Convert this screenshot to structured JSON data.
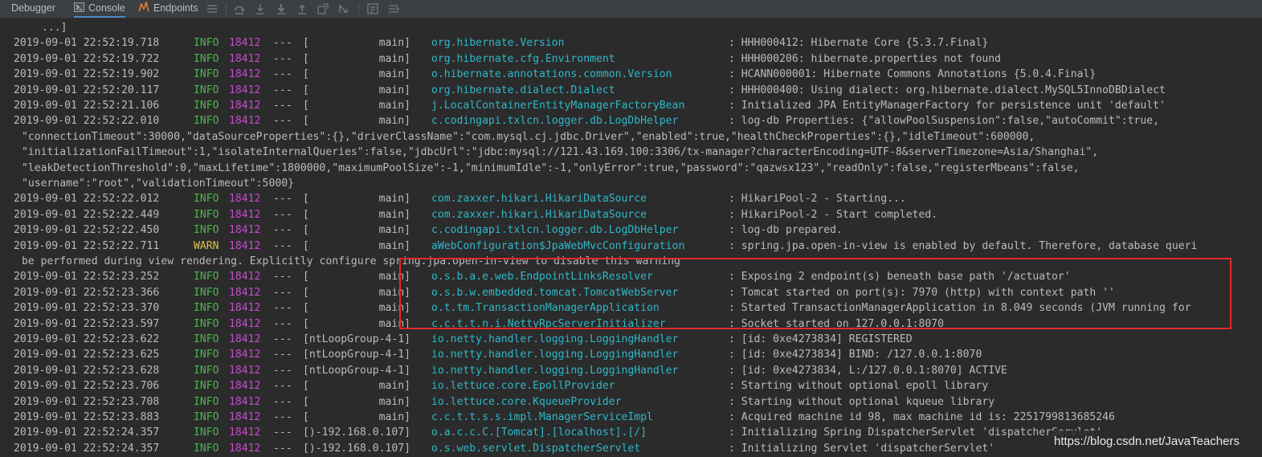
{
  "toolbar": {
    "tabs": [
      {
        "label": "Debugger",
        "active": false
      },
      {
        "label": "Console",
        "active": true
      },
      {
        "label": "Endpoints",
        "active": false
      }
    ]
  },
  "console": {
    "continuation_top": "...]",
    "rows": [
      {
        "time": "2019-09-01 22:52:19.718",
        "level": "INFO",
        "pid": "18412",
        "sep": "---",
        "thread": "[           main]",
        "logger": "org.hibernate.Version",
        "message": ": HHH000412: Hibernate Core {5.3.7.Final}"
      },
      {
        "time": "2019-09-01 22:52:19.722",
        "level": "INFO",
        "pid": "18412",
        "sep": "---",
        "thread": "[           main]",
        "logger": "org.hibernate.cfg.Environment",
        "message": ": HHH000206: hibernate.properties not found"
      },
      {
        "time": "2019-09-01 22:52:19.902",
        "level": "INFO",
        "pid": "18412",
        "sep": "---",
        "thread": "[           main]",
        "logger": "o.hibernate.annotations.common.Version",
        "message": ": HCANN000001: Hibernate Commons Annotations {5.0.4.Final}"
      },
      {
        "time": "2019-09-01 22:52:20.117",
        "level": "INFO",
        "pid": "18412",
        "sep": "---",
        "thread": "[           main]",
        "logger": "org.hibernate.dialect.Dialect",
        "message": ": HHH000400: Using dialect: org.hibernate.dialect.MySQL5InnoDBDialect"
      },
      {
        "time": "2019-09-01 22:52:21.106",
        "level": "INFO",
        "pid": "18412",
        "sep": "---",
        "thread": "[           main]",
        "logger": "j.LocalContainerEntityManagerFactoryBean",
        "message": ": Initialized JPA EntityManagerFactory for persistence unit 'default'"
      },
      {
        "time": "2019-09-01 22:52:22.010",
        "level": "INFO",
        "pid": "18412",
        "sep": "---",
        "thread": "[           main]",
        "logger": "c.codingapi.txlcn.logger.db.LogDbHelper",
        "message": ": log-db Properties: {\"allowPoolSuspension\":false,\"autoCommit\":true,"
      },
      {
        "continuation": "\"connectionTimeout\":30000,\"dataSourceProperties\":{},\"driverClassName\":\"com.mysql.cj.jdbc.Driver\",\"enabled\":true,\"healthCheckProperties\":{},\"idleTimeout\":600000,"
      },
      {
        "continuation": "\"initializationFailTimeout\":1,\"isolateInternalQueries\":false,\"jdbcUrl\":\"jdbc:mysql://121.43.169.100:3306/tx-manager?characterEncoding=UTF-8&serverTimezone=Asia/Shanghai\","
      },
      {
        "continuation": "\"leakDetectionThreshold\":0,\"maxLifetime\":1800000,\"maximumPoolSize\":-1,\"minimumIdle\":-1,\"onlyError\":true,\"password\":\"qazwsx123\",\"readOnly\":false,\"registerMbeans\":false,"
      },
      {
        "continuation": "\"username\":\"root\",\"validationTimeout\":5000}"
      },
      {
        "time": "2019-09-01 22:52:22.012",
        "level": "INFO",
        "pid": "18412",
        "sep": "---",
        "thread": "[           main]",
        "logger": "com.zaxxer.hikari.HikariDataSource",
        "message": ": HikariPool-2 - Starting..."
      },
      {
        "time": "2019-09-01 22:52:22.449",
        "level": "INFO",
        "pid": "18412",
        "sep": "---",
        "thread": "[           main]",
        "logger": "com.zaxxer.hikari.HikariDataSource",
        "message": ": HikariPool-2 - Start completed."
      },
      {
        "time": "2019-09-01 22:52:22.450",
        "level": "INFO",
        "pid": "18412",
        "sep": "---",
        "thread": "[           main]",
        "logger": "c.codingapi.txlcn.logger.db.LogDbHelper",
        "message": ": log-db prepared."
      },
      {
        "time": "2019-09-01 22:52:22.711",
        "level": "WARN",
        "pid": "18412",
        "sep": "---",
        "thread": "[           main]",
        "logger": "aWebConfiguration$JpaWebMvcConfiguration",
        "message": ": spring.jpa.open-in-view is enabled by default. Therefore, database queri"
      },
      {
        "continuation": "be performed during view rendering. Explicitly configure spring.jpa.open-in-view to disable this warning"
      },
      {
        "time": "2019-09-01 22:52:23.252",
        "level": "INFO",
        "pid": "18412",
        "sep": "---",
        "thread": "[           main]",
        "logger": "o.s.b.a.e.web.EndpointLinksResolver",
        "message": ": Exposing 2 endpoint(s) beneath base path '/actuator'"
      },
      {
        "time": "2019-09-01 22:52:23.366",
        "level": "INFO",
        "pid": "18412",
        "sep": "---",
        "thread": "[           main]",
        "logger": "o.s.b.w.embedded.tomcat.TomcatWebServer",
        "message": ": Tomcat started on port(s): 7970 (http) with context path ''"
      },
      {
        "time": "2019-09-01 22:52:23.370",
        "level": "INFO",
        "pid": "18412",
        "sep": "---",
        "thread": "[           main]",
        "logger": "o.t.tm.TransactionManagerApplication",
        "message": ": Started TransactionManagerApplication in 8.049 seconds (JVM running for"
      },
      {
        "time": "2019-09-01 22:52:23.597",
        "level": "INFO",
        "pid": "18412",
        "sep": "---",
        "thread": "[           main]",
        "logger": "c.c.t.t.n.i.NettyRpcServerInitializer",
        "message": ": Socket started on 127.0.0.1:8070"
      },
      {
        "time": "2019-09-01 22:52:23.622",
        "level": "INFO",
        "pid": "18412",
        "sep": "---",
        "thread": "[ntLoopGroup-4-1]",
        "logger": "io.netty.handler.logging.LoggingHandler",
        "message": ": [id: 0xe4273834] REGISTERED"
      },
      {
        "time": "2019-09-01 22:52:23.625",
        "level": "INFO",
        "pid": "18412",
        "sep": "---",
        "thread": "[ntLoopGroup-4-1]",
        "logger": "io.netty.handler.logging.LoggingHandler",
        "message": ": [id: 0xe4273834] BIND: /127.0.0.1:8070"
      },
      {
        "time": "2019-09-01 22:52:23.628",
        "level": "INFO",
        "pid": "18412",
        "sep": "---",
        "thread": "[ntLoopGroup-4-1]",
        "logger": "io.netty.handler.logging.LoggingHandler",
        "message": ": [id: 0xe4273834, L:/127.0.0.1:8070] ACTIVE"
      },
      {
        "time": "2019-09-01 22:52:23.706",
        "level": "INFO",
        "pid": "18412",
        "sep": "---",
        "thread": "[           main]",
        "logger": "io.lettuce.core.EpollProvider",
        "message": ": Starting without optional epoll library"
      },
      {
        "time": "2019-09-01 22:52:23.708",
        "level": "INFO",
        "pid": "18412",
        "sep": "---",
        "thread": "[           main]",
        "logger": "io.lettuce.core.KqueueProvider",
        "message": ": Starting without optional kqueue library"
      },
      {
        "time": "2019-09-01 22:52:23.883",
        "level": "INFO",
        "pid": "18412",
        "sep": "---",
        "thread": "[           main]",
        "logger": "c.c.t.t.s.s.impl.ManagerServiceImpl",
        "message": ": Acquired machine id 98, max machine id is: 2251799813685246"
      },
      {
        "time": "2019-09-01 22:52:24.357",
        "level": "INFO",
        "pid": "18412",
        "sep": "---",
        "thread": "[)-192.168.0.107]",
        "logger": "o.a.c.c.C.[Tomcat].[localhost].[/]",
        "message": ": Initializing Spring DispatcherServlet 'dispatcherServlet'"
      },
      {
        "time": "2019-09-01 22:52:24.357",
        "level": "INFO",
        "pid": "18412",
        "sep": "---",
        "thread": "[)-192.168.0.107]",
        "logger": "o.s.web.servlet.DispatcherServlet",
        "message": ": Initializing Servlet 'dispatcherServlet'"
      }
    ]
  },
  "watermark": "https://blog.csdn.net/JavaTeachers",
  "colors": {
    "background": "#2b2b2b",
    "info": "#4fb54f",
    "warn": "#e0c24a",
    "pid": "#c54dcf",
    "logger": "#2eb8c9",
    "highlight": "#e02a2a"
  }
}
